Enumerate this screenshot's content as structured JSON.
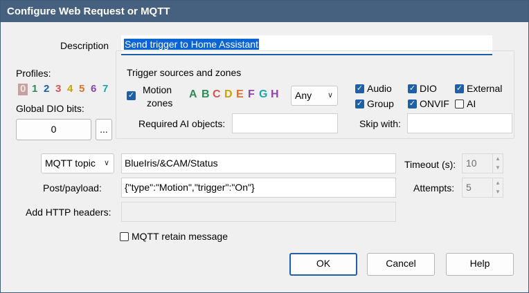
{
  "window": {
    "title": "Configure Web Request or MQTT"
  },
  "description": {
    "label": "Description",
    "value": "Send trigger to Home Assistant"
  },
  "profiles": {
    "label": "Profiles:",
    "digits": [
      "0",
      "1",
      "2",
      "3",
      "4",
      "5",
      "6",
      "7"
    ],
    "colors": [
      "#b0b0b0",
      "#2e8b57",
      "#1f5fa8",
      "#d9534f",
      "#c9a400",
      "#d9722b",
      "#8e44ad",
      "#1aa8a8"
    ]
  },
  "global_dio": {
    "label": "Global DIO bits:",
    "value": "0",
    "more_button": "..."
  },
  "trigger": {
    "group_label": "Trigger sources and zones",
    "motion_zones_label_1": "Motion",
    "motion_zones_label_2": "zones",
    "zone_letters": [
      "A",
      "B",
      "C",
      "D",
      "E",
      "F",
      "G",
      "H"
    ],
    "zone_colors": [
      "#2e8b57",
      "#2e8b57",
      "#d9534f",
      "#c9a400",
      "#d9722b",
      "#8e44ad",
      "#1aa8a8",
      "#8e44ad"
    ],
    "zone_combo": "Any",
    "audio": "Audio",
    "dio": "DIO",
    "external": "External",
    "group": "Group",
    "onvif": "ONVIF",
    "ai": "AI",
    "required_ai_label": "Required AI objects:",
    "required_ai_value": "",
    "skip_with_label": "Skip with:",
    "skip_with_value": ""
  },
  "request": {
    "type": "MQTT topic",
    "topic": "BlueIris/&CAM/Status",
    "payload_label": "Post/payload:",
    "payload": "{\"type\":\"Motion\",\"trigger\":\"On\"}",
    "headers_label": "Add HTTP headers:",
    "headers_value": "",
    "retain_label": "MQTT retain message",
    "timeout_label": "Timeout (s):",
    "timeout_value": "10",
    "attempts_label": "Attempts:",
    "attempts_value": "5"
  },
  "buttons": {
    "ok": "OK",
    "cancel": "Cancel",
    "help": "Help"
  }
}
